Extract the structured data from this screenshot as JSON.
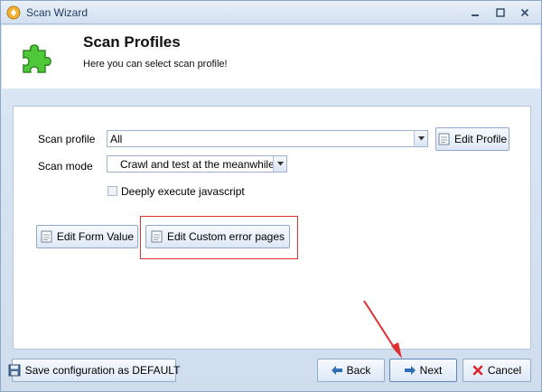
{
  "window": {
    "title": "Scan Wizard"
  },
  "icons": {
    "app": "scan-wizard-app-icon",
    "header": "puzzle-piece-icon",
    "edit": "document-edit-icon",
    "save": "floppy-disk-icon",
    "back": "arrow-left-icon",
    "next": "arrow-right-icon",
    "cancel": "red-x-icon"
  },
  "colors": {
    "accent": "#2f6fb8",
    "highlight": "#e03030",
    "cancel": "#d9272e"
  },
  "header": {
    "title": "Scan Profiles",
    "subtitle": "Here you can select scan profile!"
  },
  "form": {
    "scan_profile_label": "Scan profile",
    "scan_profile_value": "All",
    "edit_profile_button": "Edit Profile",
    "scan_mode_label": "Scan mode",
    "scan_mode_value": "Crawl and test at the meanwhile",
    "deeply_execute_label": "Deeply execute javascript",
    "deeply_execute_checked": false,
    "edit_form_value_button": "Edit Form Value",
    "edit_custom_error_button": "Edit Custom error pages"
  },
  "footer": {
    "save_button": "Save configuration as DEFAULT",
    "back_button": "Back",
    "next_button": "Next",
    "cancel_button": "Cancel"
  }
}
